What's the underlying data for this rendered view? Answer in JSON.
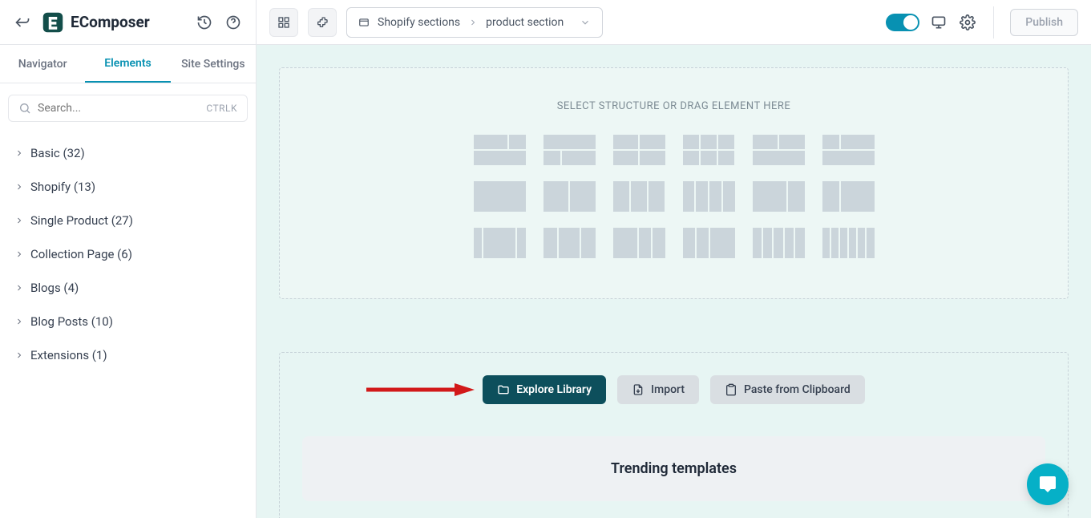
{
  "header": {
    "brand": "EComposer",
    "breadcrumb": {
      "root": "Shopify sections",
      "current": "product section"
    },
    "publish_label": "Publish"
  },
  "sidebar": {
    "tabs": [
      {
        "label": "Navigator",
        "active": false
      },
      {
        "label": "Elements",
        "active": true
      },
      {
        "label": "Site Settings",
        "active": false
      }
    ],
    "search": {
      "placeholder": "Search...",
      "shortcut": "CTRLK"
    },
    "categories": [
      {
        "label": "Basic (32)"
      },
      {
        "label": "Shopify (13)"
      },
      {
        "label": "Single Product (27)"
      },
      {
        "label": "Collection Page (6)"
      },
      {
        "label": "Blogs (4)"
      },
      {
        "label": "Blog Posts (10)"
      },
      {
        "label": "Extensions (1)"
      }
    ]
  },
  "canvas": {
    "drop_hint": "SELECT STRUCTURE OR DRAG ELEMENT HERE",
    "actions": {
      "explore": "Explore Library",
      "import": "Import",
      "paste": "Paste from Clipboard"
    },
    "trending_title": "Trending templates"
  },
  "colors": {
    "accent": "#0891b2",
    "primary_btn": "#0d4f5c",
    "annotation": "#d21919"
  }
}
